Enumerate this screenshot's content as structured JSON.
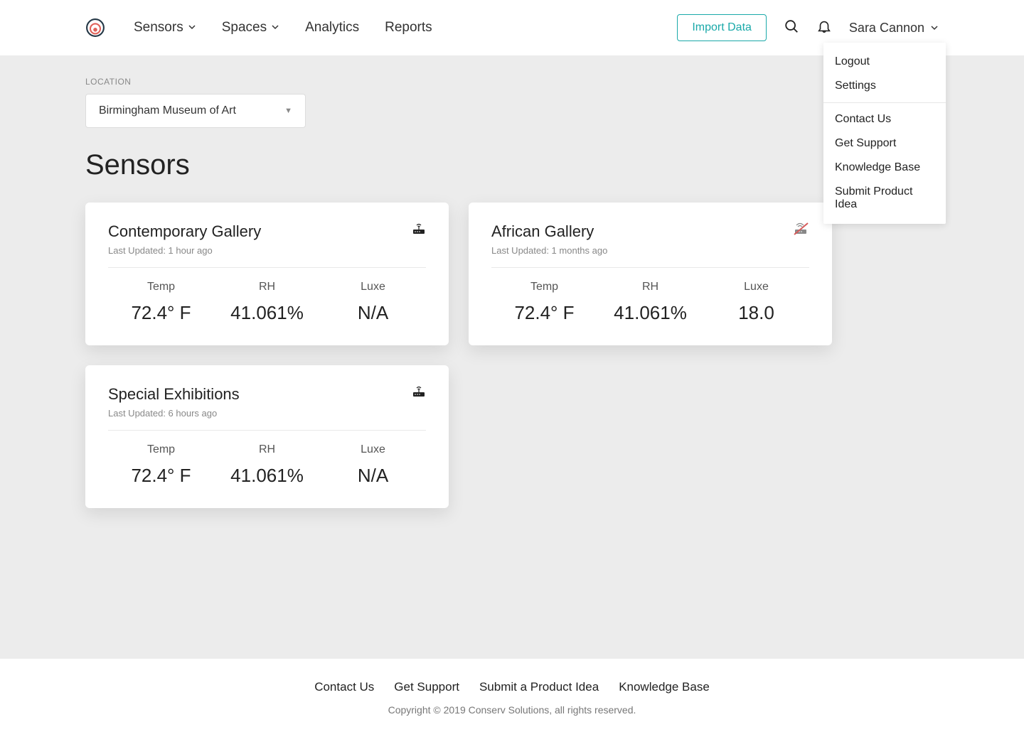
{
  "header": {
    "nav": {
      "sensors": "Sensors",
      "spaces": "Spaces",
      "analytics": "Analytics",
      "reports": "Reports"
    },
    "import_btn": "Import Data",
    "user_name": "Sara Cannon"
  },
  "dropdown": {
    "logout": "Logout",
    "settings": "Settings",
    "contact": "Contact Us",
    "support": "Get Support",
    "kb": "Knowledge Base",
    "idea": "Submit Product Idea"
  },
  "location": {
    "label": "LOCATION",
    "selected": "Birmingham Museum of Art"
  },
  "page_title": "Sensors",
  "metric_labels": {
    "temp": "Temp",
    "rh": "RH",
    "luxe": "Luxe"
  },
  "cards": [
    {
      "title": "Contemporary Gallery",
      "updated": "Last Updated: 1 hour ago",
      "status": "online",
      "temp": "72.4° F",
      "rh": "41.061%",
      "luxe": "N/A"
    },
    {
      "title": "African Gallery",
      "updated": "Last Updated: 1 months ago",
      "status": "offline",
      "temp": "72.4° F",
      "rh": "41.061%",
      "luxe": "18.0"
    },
    {
      "title": "Special Exhibitions",
      "updated": "Last Updated: 6 hours ago",
      "status": "online",
      "temp": "72.4° F",
      "rh": "41.061%",
      "luxe": "N/A"
    }
  ],
  "footer": {
    "links": {
      "contact": "Contact Us",
      "support": "Get Support",
      "idea": "Submit a Product Idea",
      "kb": "Knowledge Base"
    },
    "copyright": "Copyright © 2019 Conserv Solutions, all rights reserved."
  }
}
